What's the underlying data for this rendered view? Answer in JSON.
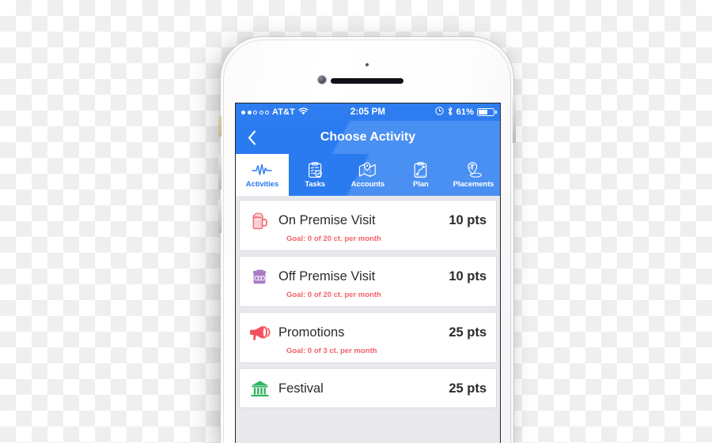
{
  "device": {
    "name": "white-iphone",
    "hardware": [
      "silent-switch",
      "volume-up-button",
      "volume-down-button",
      "power-button",
      "front-camera",
      "earpiece-speaker",
      "proximity-sensor"
    ]
  },
  "status_bar": {
    "signal_dots_filled": 2,
    "signal_dots_total": 5,
    "carrier": "AT&T",
    "wifi": "wifi-icon",
    "time": "2:05 PM",
    "alarm": "alarm-icon",
    "bluetooth": "bluetooth-icon",
    "battery_percent": "61%",
    "battery_level": 61
  },
  "nav_bar": {
    "back_label": "‹",
    "title": "Choose Activity"
  },
  "tabs": [
    {
      "label": "Activities",
      "icon": "pulse-icon",
      "active": true
    },
    {
      "label": "Tasks",
      "icon": "clipboard-check-icon",
      "active": false
    },
    {
      "label": "Accounts",
      "icon": "map-pin-icon",
      "active": false
    },
    {
      "label": "Plan",
      "icon": "clipboard-route-icon",
      "active": false
    },
    {
      "label": "Placements",
      "icon": "pin-dollar-icon",
      "active": false
    }
  ],
  "activities": [
    {
      "title": "On Premise Visit",
      "points": "10 pts",
      "goal": "Goal: 0 of 20 ct. per month",
      "icon": "beer-mug-icon",
      "icon_color": "#f2737f"
    },
    {
      "title": "Off Premise Visit",
      "points": "10 pts",
      "goal": "Goal: 0 of 20 ct. per month",
      "icon": "six-pack-icon",
      "icon_color": "#a979c4"
    },
    {
      "title": "Promotions",
      "points": "25 pts",
      "goal": "Goal: 0 of 3 ct. per month",
      "icon": "megaphone-icon",
      "icon_color": "#f4505e"
    },
    {
      "title": "Festival",
      "points": "25 pts",
      "goal": "",
      "icon": "bank-building-icon",
      "icon_color": "#32b562"
    }
  ],
  "colors": {
    "brand_blue": "#2a7bef",
    "brand_blue_light": "#4a90f2",
    "goal_red": "#f4606a",
    "list_background": "#e8e8ed",
    "text_dark": "#2b2b2e"
  }
}
